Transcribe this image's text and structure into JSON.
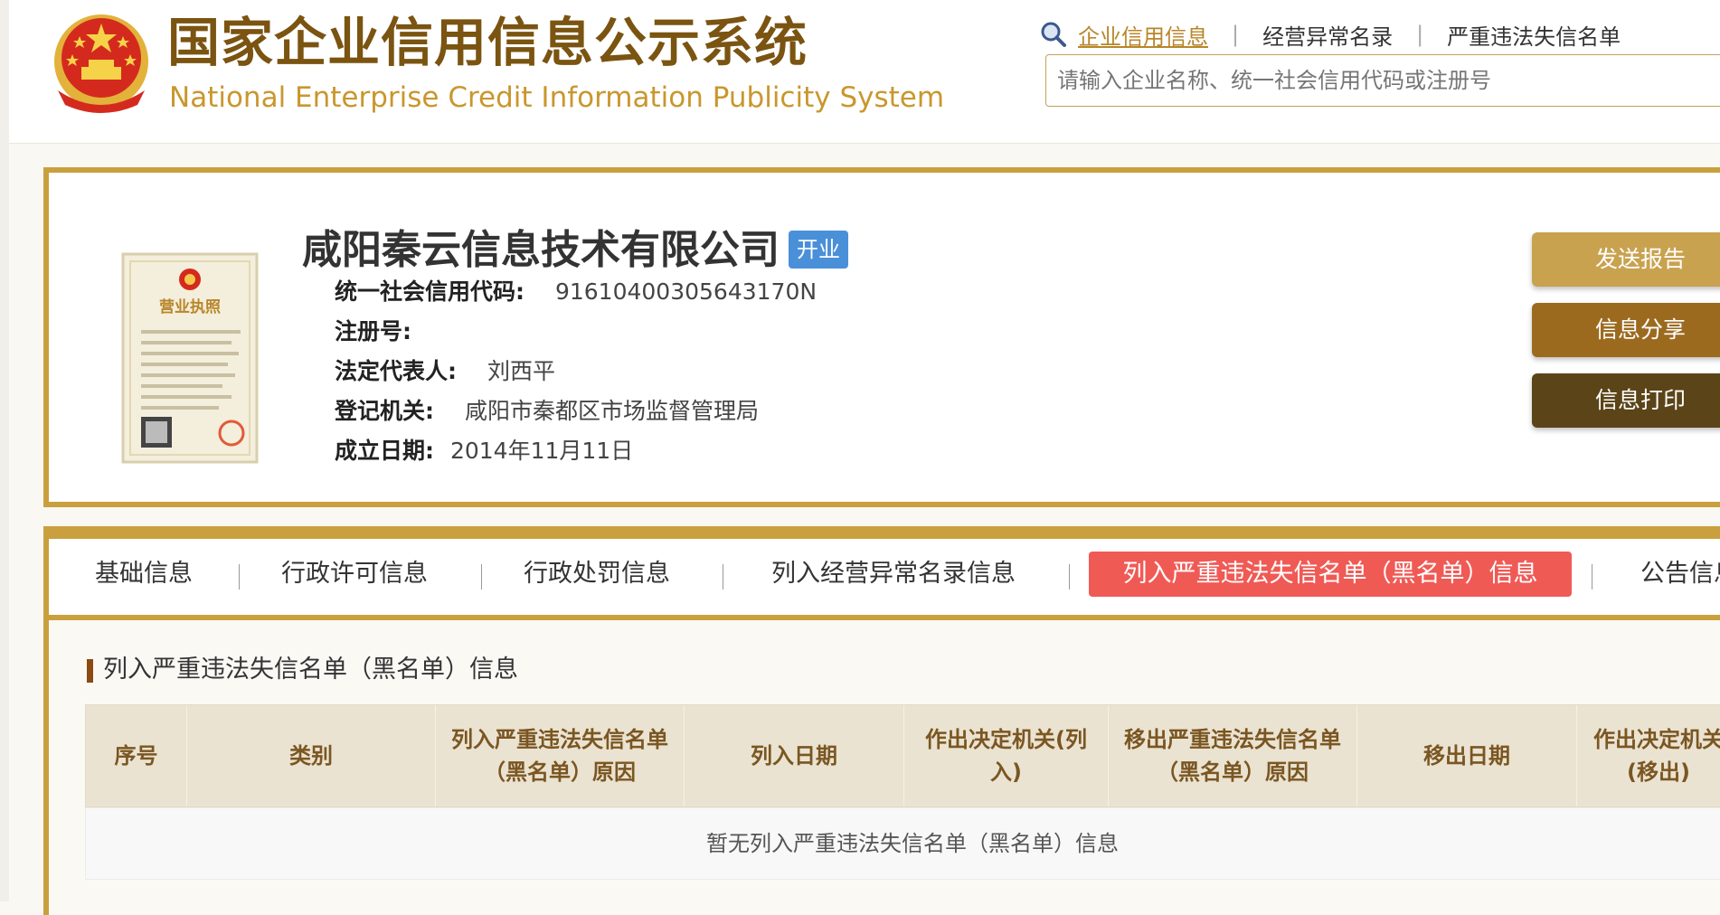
{
  "header": {
    "title_cn": "国家企业信用信息公示系统",
    "title_en": "National Enterprise Credit Information Publicity System",
    "nav": [
      {
        "label": "企业信用信息",
        "active": true
      },
      {
        "label": "经营异常名录",
        "active": false
      },
      {
        "label": "严重违法失信名单",
        "active": false
      }
    ],
    "search_placeholder": "请输入企业名称、统一社会信用代码或注册号"
  },
  "company": {
    "name": "咸阳秦云信息技术有限公司",
    "status": "开业",
    "license_caption": "营业执照",
    "fields": [
      {
        "label": "统一社会信用代码:",
        "value": "91610400305643170N"
      },
      {
        "label": "注册号:",
        "value": ""
      },
      {
        "label": "法定代表人:",
        "value": "刘西平"
      },
      {
        "label": "登记机关:",
        "value": "咸阳市秦都区市场监督管理局"
      },
      {
        "label": "成立日期:",
        "value": "2014年11月11日"
      }
    ]
  },
  "actions": {
    "send_report": "发送报告",
    "share": "信息分享",
    "print": "信息打印"
  },
  "tabs": [
    {
      "label": "基础信息",
      "active": false
    },
    {
      "label": "行政许可信息",
      "active": false
    },
    {
      "label": "行政处罚信息",
      "active": false
    },
    {
      "label": "列入经营异常名录信息",
      "active": false
    },
    {
      "label": "列入严重违法失信名单（黑名单）信息",
      "active": true
    },
    {
      "label": "公告信息",
      "active": false
    }
  ],
  "section": {
    "title": "列入严重违法失信名单（黑名单）信息",
    "columns": [
      "序号",
      "类别",
      "列入严重违法失信名单（黑名单）原因",
      "列入日期",
      "作出决定机关(列入)",
      "移出严重违法失信名单（黑名单）原因",
      "移出日期",
      "作出决定机关(移出)"
    ],
    "empty_text": "暂无列入严重违法失信名单（黑名单）信息"
  },
  "colors": {
    "gold": "#c9a03d",
    "brown": "#7a5410",
    "active_tab": "#f05a55",
    "status_badge": "#4a90d9"
  }
}
